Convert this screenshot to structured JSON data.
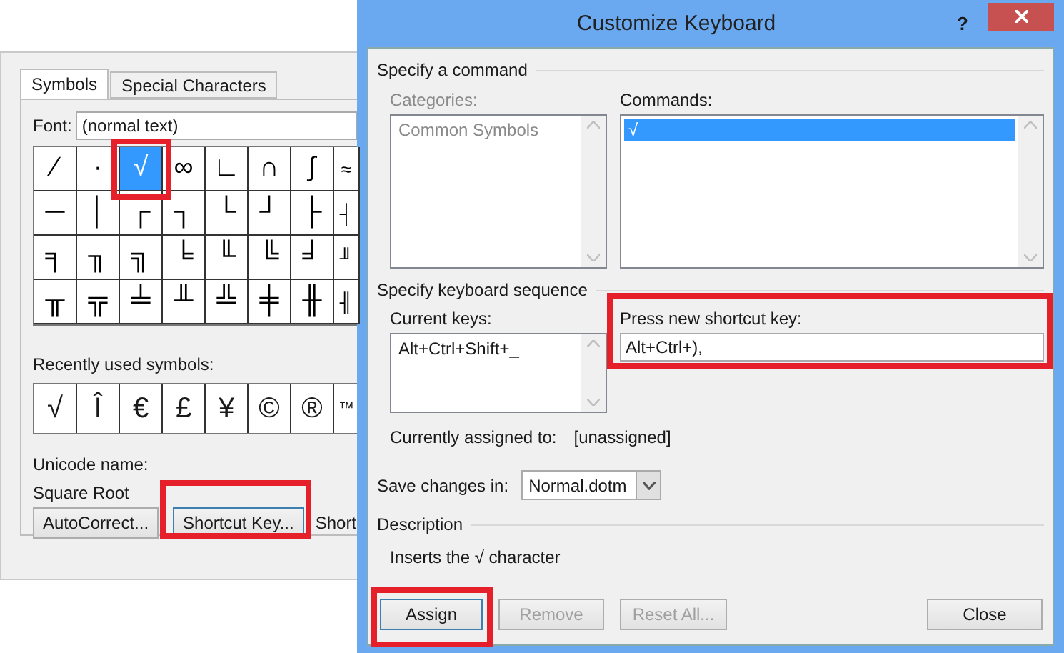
{
  "symbol_dialog": {
    "tabs": [
      {
        "label": "Symbols",
        "selected": true
      },
      {
        "label": "Special Characters",
        "selected": false
      }
    ],
    "font": {
      "label": "Font:",
      "value": "(normal text)"
    },
    "symbol_rows": [
      [
        {
          "char": "⁄",
          "selected": false,
          "highlighted": false
        },
        {
          "char": "·",
          "selected": false,
          "highlighted": false
        },
        {
          "char": "√",
          "selected": true,
          "highlighted": true
        },
        {
          "char": "∞",
          "selected": false,
          "highlighted": false
        },
        {
          "char": "∟",
          "selected": false,
          "highlighted": false
        },
        {
          "char": "∩",
          "selected": false,
          "highlighted": false
        },
        {
          "char": "∫",
          "selected": false,
          "highlighted": false
        },
        {
          "char": "≈",
          "selected": false,
          "highlighted": false
        }
      ],
      [
        {
          "char": "─",
          "selected": false,
          "highlighted": false
        },
        {
          "char": "│",
          "selected": false,
          "highlighted": false
        },
        {
          "char": "┌",
          "selected": false,
          "highlighted": false
        },
        {
          "char": "┐",
          "selected": false,
          "highlighted": false
        },
        {
          "char": "└",
          "selected": false,
          "highlighted": false
        },
        {
          "char": "┘",
          "selected": false,
          "highlighted": false
        },
        {
          "char": "├",
          "selected": false,
          "highlighted": false
        },
        {
          "char": "┤",
          "selected": false,
          "highlighted": false
        }
      ],
      [
        {
          "char": "╕",
          "selected": false,
          "highlighted": false
        },
        {
          "char": "╖",
          "selected": false,
          "highlighted": false
        },
        {
          "char": "╗",
          "selected": false,
          "highlighted": false
        },
        {
          "char": "╘",
          "selected": false,
          "highlighted": false
        },
        {
          "char": "╙",
          "selected": false,
          "highlighted": false
        },
        {
          "char": "╚",
          "selected": false,
          "highlighted": false
        },
        {
          "char": "╛",
          "selected": false,
          "highlighted": false
        },
        {
          "char": "╜",
          "selected": false,
          "highlighted": false
        }
      ],
      [
        {
          "char": "╥",
          "selected": false,
          "highlighted": false
        },
        {
          "char": "╦",
          "selected": false,
          "highlighted": false
        },
        {
          "char": "╧",
          "selected": false,
          "highlighted": false
        },
        {
          "char": "╨",
          "selected": false,
          "highlighted": false
        },
        {
          "char": "╩",
          "selected": false,
          "highlighted": false
        },
        {
          "char": "╪",
          "selected": false,
          "highlighted": false
        },
        {
          "char": "╫",
          "selected": false,
          "highlighted": false
        },
        {
          "char": "╢",
          "selected": false,
          "highlighted": false
        }
      ]
    ],
    "recent_label": "Recently used symbols:",
    "recent_symbols": [
      "√",
      "Î",
      "€",
      "£",
      "¥",
      "©",
      "®",
      "™"
    ],
    "unicode_name_label": "Unicode name:",
    "unicode_name": "Square Root",
    "buttons": [
      {
        "label": "AutoCorrect...",
        "focused": false,
        "highlighted": false
      },
      {
        "label": "Shortcut Key...",
        "focused": true,
        "highlighted": true
      }
    ],
    "shortcut_text": "Short"
  },
  "keyboard_dialog": {
    "title": "Customize Keyboard",
    "help": "?",
    "command_section": "Specify a command",
    "categories": {
      "label": "Categories:",
      "disabled": true,
      "items": [
        {
          "label": "Common Symbols",
          "selected": false
        }
      ]
    },
    "commands": {
      "label": "Commands:",
      "disabled": false,
      "items": [
        {
          "label": "√",
          "selected": true
        }
      ]
    },
    "sequence_section": "Specify keyboard sequence",
    "current_keys": {
      "label": "Current keys:",
      "items": [
        "Alt+Ctrl+Shift+_"
      ]
    },
    "new_key": {
      "label": "Press new shortcut key:",
      "value": "Alt+Ctrl+),",
      "highlighted": true
    },
    "assigned_label": "Currently assigned to:",
    "assigned_value": "[unassigned]",
    "save_label": "Save changes in:",
    "save_value": "Normal.dotm",
    "description_section": "Description",
    "description": "Inserts the √ character",
    "buttons": [
      {
        "label": "Assign",
        "disabled": false,
        "focused": true,
        "highlighted": true
      },
      {
        "label": "Remove",
        "disabled": true,
        "focused": false,
        "highlighted": false
      },
      {
        "label": "Reset All...",
        "disabled": true,
        "focused": false,
        "highlighted": false
      },
      {
        "label": "Close",
        "disabled": false,
        "focused": false,
        "highlighted": false
      }
    ]
  }
}
